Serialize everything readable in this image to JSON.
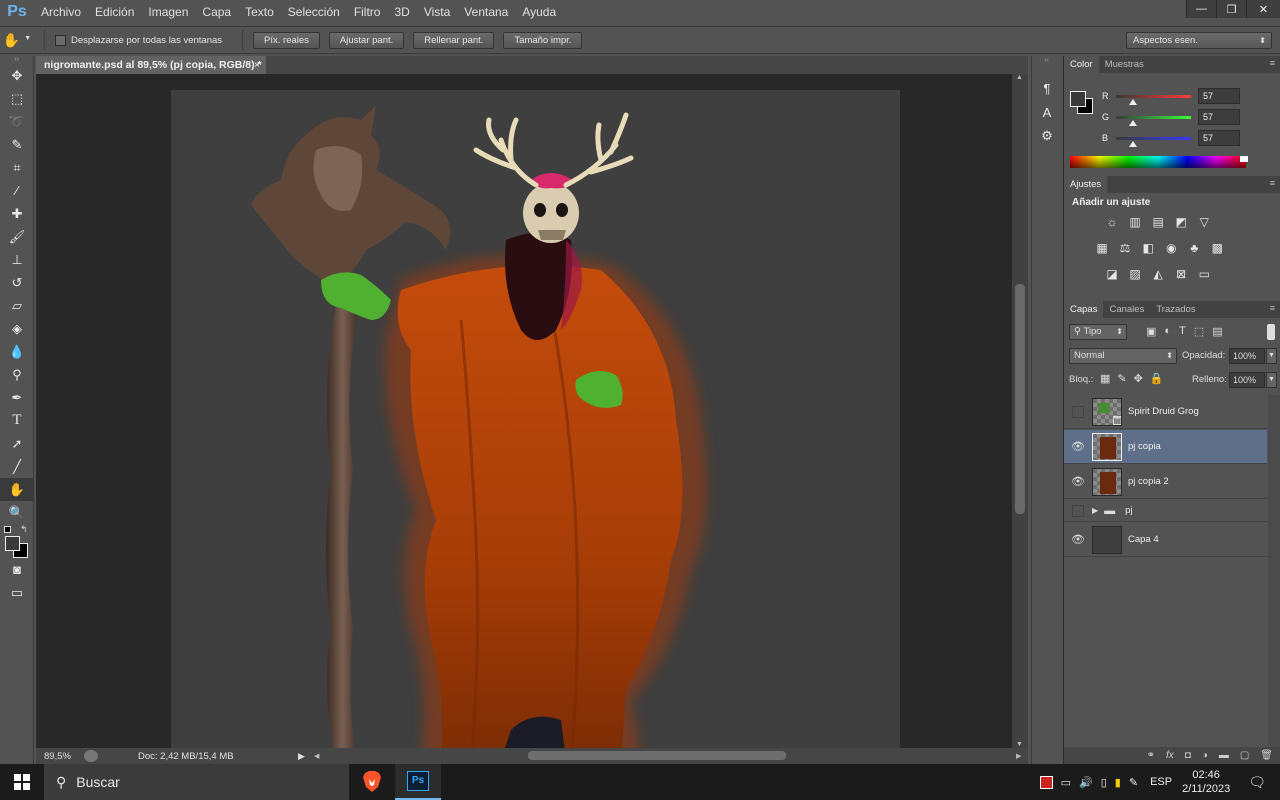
{
  "app": {
    "logo": "Ps"
  },
  "menubar": {
    "items": [
      "Archivo",
      "Edición",
      "Imagen",
      "Capa",
      "Texto",
      "Selección",
      "Filtro",
      "3D",
      "Vista",
      "Ventana",
      "Ayuda"
    ]
  },
  "window_controls": {
    "minimize": "—",
    "restore": "❐",
    "close": "✕"
  },
  "options_bar": {
    "scroll_all_label": "Desplazarse por todas las ventanas",
    "buttons": [
      "Píx. reales",
      "Ajustar pant.",
      "Rellenar pant.",
      "Tamaño impr."
    ],
    "workspace": "Aspectos esen."
  },
  "document": {
    "tab_title": "nigromante.psd al 89,5% (pj copia, RGB/8) *",
    "tab_close": "×"
  },
  "status": {
    "zoom": "89,5%",
    "doc_size": "Doc: 2,42 MB/15,4 MB"
  },
  "color_panel": {
    "tabs": [
      "Color",
      "Muestras"
    ],
    "channels": [
      {
        "label": "R",
        "value": "57"
      },
      {
        "label": "G",
        "value": "57"
      },
      {
        "label": "B",
        "value": "57"
      }
    ],
    "level": 0.22
  },
  "adjustments_panel": {
    "tab": "Ajustes",
    "heading": "Añadir un ajuste"
  },
  "layers_panel": {
    "tabs": [
      "Capas",
      "Canales",
      "Trazados"
    ],
    "filter": "Tipo",
    "blend_mode": "Normal",
    "opacity_label": "Opacidad:",
    "opacity_value": "100%",
    "lock_label": "Bloq.:",
    "fill_label": "Relleno:",
    "fill_value": "100%",
    "layers": [
      {
        "name": "Spirit Druid Grog",
        "visible": false,
        "selected": false
      },
      {
        "name": "pj copia",
        "visible": true,
        "selected": true
      },
      {
        "name": "pj copia 2",
        "visible": true,
        "selected": false
      },
      {
        "name": "pj",
        "visible": false,
        "selected": false
      },
      {
        "name": "Capa 4",
        "visible": true,
        "selected": false
      }
    ],
    "bottom_icons": [
      "link-icon",
      "fx-icon",
      "mask-icon",
      "adjustment-icon",
      "folder-icon",
      "new-layer-icon",
      "trash-icon"
    ]
  },
  "taskbar": {
    "search_placeholder": "Buscar",
    "language": "ESP",
    "time": "02:46",
    "date": "2/11/2023"
  },
  "colors": {
    "accent": "#2d7cd3",
    "canvas_bg": "#3f3f3f",
    "robe": "#b5420a",
    "selection": "#5f6f8a"
  }
}
